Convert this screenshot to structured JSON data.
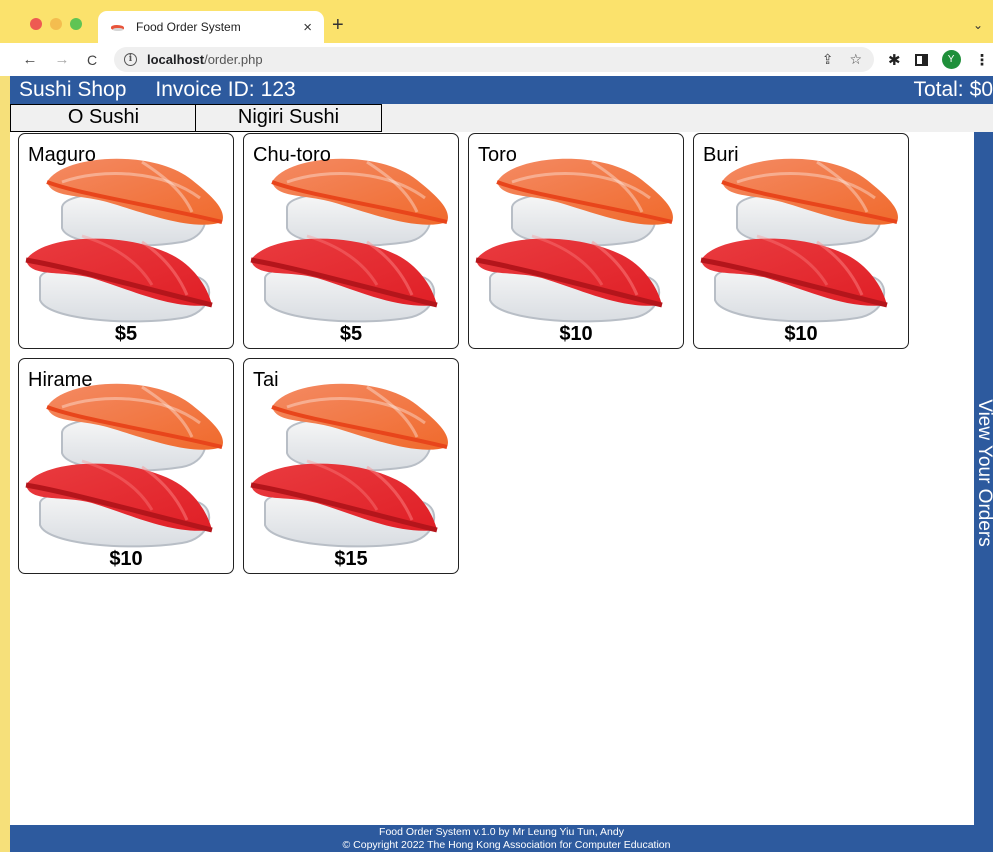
{
  "browser": {
    "tab_title": "Food Order System",
    "tab_close": "×",
    "new_tab": "+",
    "url_host": "localhost",
    "url_path": "/order.php",
    "avatar_initial": "Y"
  },
  "header": {
    "shop_name": "Sushi Shop",
    "invoice_label": "Invoice ID:",
    "invoice_id": "123",
    "total_label": "Total:",
    "total_value": "$0"
  },
  "categories": [
    {
      "label": "O Sushi"
    },
    {
      "label": "Nigiri Sushi"
    }
  ],
  "items": [
    {
      "name": "Maguro",
      "price": "$5"
    },
    {
      "name": "Chu-toro",
      "price": "$5"
    },
    {
      "name": "Toro",
      "price": "$10"
    },
    {
      "name": "Buri",
      "price": "$10"
    },
    {
      "name": "Hirame",
      "price": "$10"
    },
    {
      "name": "Tai",
      "price": "$15"
    }
  ],
  "side_panel": {
    "label": "View Your Orders"
  },
  "footer": {
    "line1": "Food Order System v.1.0 by Mr Leung Yiu Tun, Andy",
    "line2": "© Copyright 2022 The Hong Kong Association for Computer Education"
  },
  "colors": {
    "brand_blue": "#2d5a9e",
    "browser_chrome": "#fbe26c"
  },
  "icons": [
    "sushi-image",
    "info-icon",
    "share-icon",
    "star-icon",
    "extensions-icon",
    "side-panel-icon",
    "menu-icon"
  ]
}
